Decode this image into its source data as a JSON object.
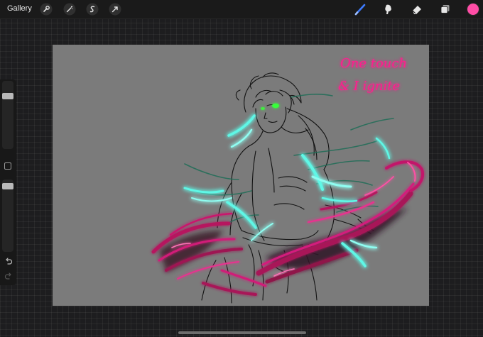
{
  "topbar": {
    "gallery_label": "Gallery",
    "left_tools": [
      "wrench-icon",
      "magic-wand-icon",
      "selection-icon",
      "transform-arrow-icon"
    ],
    "right_tools": [
      "brush-icon",
      "smudge-icon",
      "eraser-icon",
      "layers-icon"
    ],
    "active_tool": "brush-icon",
    "active_tool_color": "#3d7bff",
    "current_color": "#ff4da6"
  },
  "sidebar": {
    "brush_size_level": 0.2,
    "opacity_level": 0.05,
    "buttons": [
      "modify-button",
      "undo-icon",
      "redo-icon"
    ]
  },
  "canvas": {
    "background_color": "#7b7b7b",
    "handwritten_text": [
      "One touch",
      "& I ignite"
    ],
    "accent_colors": {
      "text_glow": "#ff1f8e",
      "pink_effect": "#b6145f",
      "cyan_effect": "#5ff7e6",
      "green_eye": "#38ff3a"
    }
  }
}
